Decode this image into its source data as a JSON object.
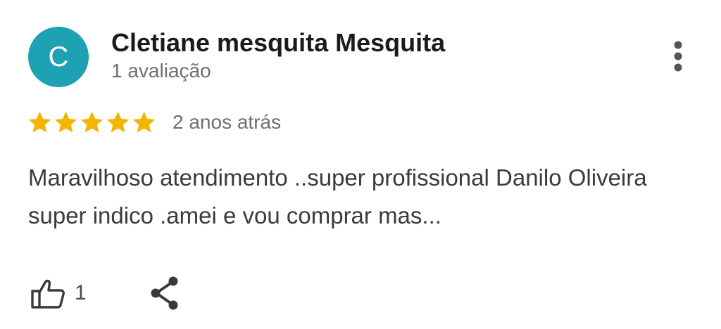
{
  "review": {
    "avatar_initial": "C",
    "avatar_color": "#1ea1b3",
    "reviewer_name": "Cletiane mesquita Mesquita",
    "review_count": "1 avaliação",
    "rating": 5,
    "rating_max": 5,
    "star_color": "#f4b400",
    "date": "2 anos atrás",
    "text": "Maravilhoso atendimento ..super profissional Danilo Oliveira super indico .amei e vou comprar mas...",
    "like_count": "1",
    "icons": {
      "more": "more-vert-icon",
      "like": "thumb-up-icon",
      "share": "share-icon",
      "star": "star-icon"
    }
  }
}
